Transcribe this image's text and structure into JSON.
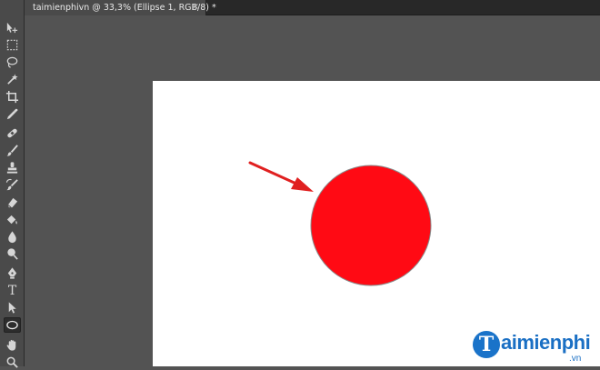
{
  "document_tab": {
    "title": "taimienphivn @ 33,3% (Ellipse 1, RGB/8) *",
    "close_glyph": "×"
  },
  "toolbar": {
    "tools": [
      {
        "name": "move-tool-icon"
      },
      {
        "name": "marquee-tool-icon"
      },
      {
        "name": "lasso-tool-icon"
      },
      {
        "name": "magic-wand-tool-icon"
      },
      {
        "name": "crop-tool-icon"
      },
      {
        "name": "eyedropper-tool-icon"
      },
      {
        "name": "healing-brush-tool-icon"
      },
      {
        "name": "brush-tool-icon"
      },
      {
        "name": "clone-stamp-tool-icon"
      },
      {
        "name": "history-brush-tool-icon"
      },
      {
        "name": "eraser-tool-icon"
      },
      {
        "name": "paint-bucket-tool-icon"
      },
      {
        "name": "blur-tool-icon"
      },
      {
        "name": "dodge-tool-icon"
      },
      {
        "name": "pen-tool-icon"
      },
      {
        "name": "type-tool-icon",
        "glyph": "T"
      },
      {
        "name": "path-selection-tool-icon"
      },
      {
        "name": "ellipse-tool-icon",
        "active": true
      },
      {
        "name": "hand-tool-icon"
      },
      {
        "name": "zoom-tool-icon"
      }
    ]
  },
  "canvas": {
    "shape": "ellipse",
    "fill_color": "#ff0a14",
    "stroke_color": "#8a8a8a",
    "arrow_color": "#e02020"
  },
  "watermark": {
    "initial": "T",
    "text": "aimienphi",
    "suffix": ".vn"
  }
}
